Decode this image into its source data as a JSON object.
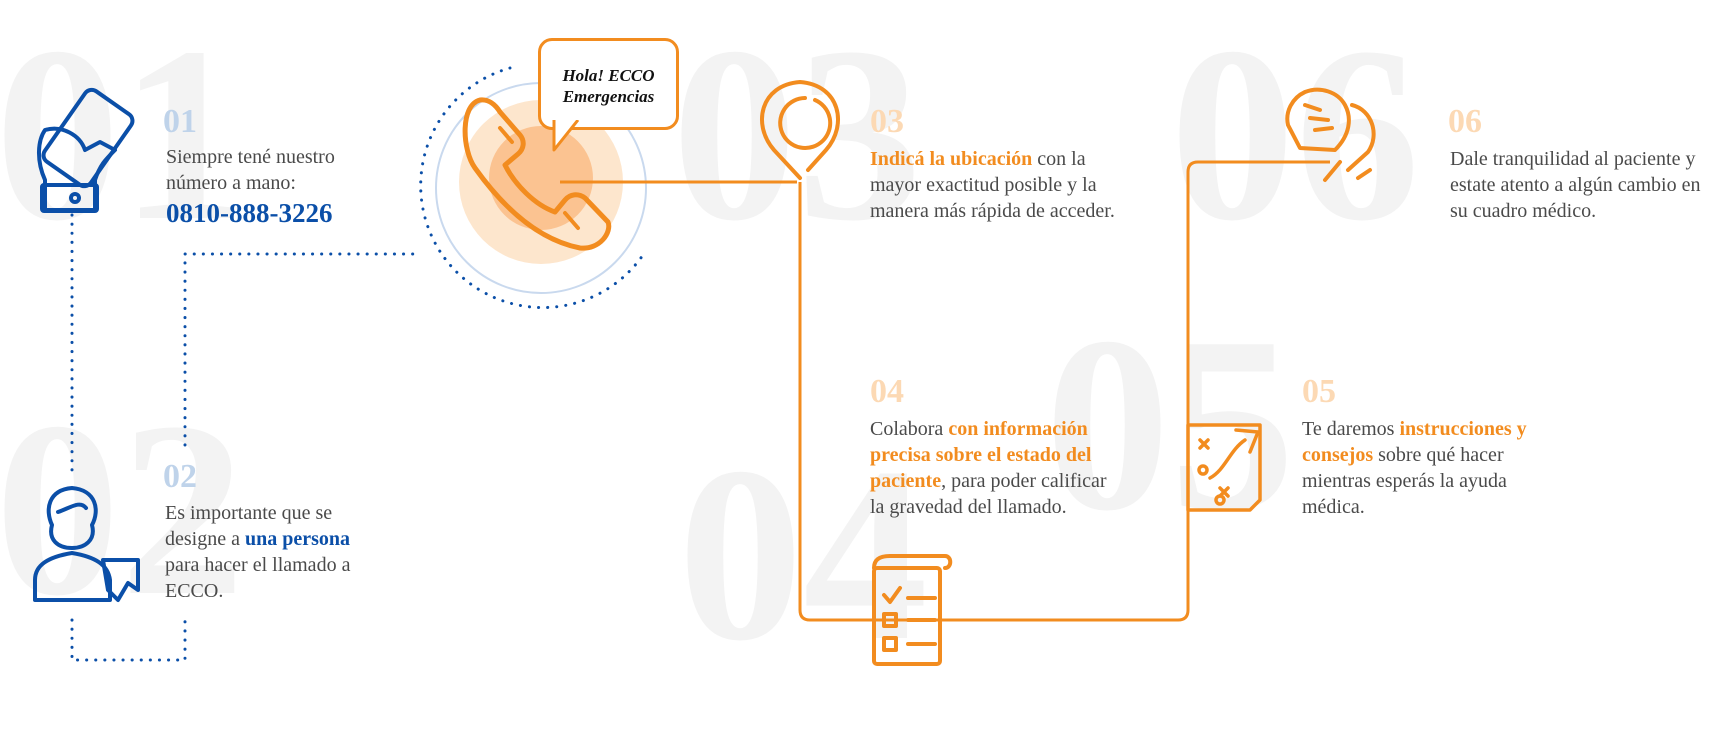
{
  "colors": {
    "orange": "#f28c1f",
    "blue": "#0b4fa8",
    "light_blue": "#bfd3ea",
    "light_orange": "#fcd9b4",
    "watermark": "#f3f3f3",
    "text": "#4a4a4a"
  },
  "watermarks": [
    "01",
    "02",
    "03",
    "04",
    "05",
    "06"
  ],
  "bubble": {
    "line1": "Hola! ECCO",
    "line2": "Emergencias"
  },
  "steps": [
    {
      "number": "01",
      "icon": "hand-phone-icon",
      "text": "Siempre tené nuestro número a mano:",
      "phone": "0810-888-3226"
    },
    {
      "number": "02",
      "icon": "woman-badge-icon",
      "text_before": "Es importante que se designe a ",
      "highlight": "una persona",
      "text_after": " para hacer el llamado a ECCO."
    },
    {
      "number": "03",
      "icon": "location-pin-icon",
      "highlight": "Indicá la ubicación",
      "text_after": " con la mayor exactitud posible y la manera más rápida de acceder."
    },
    {
      "number": "04",
      "icon": "checklist-icon",
      "text_before": "Colabora ",
      "highlight": "con información precisa sobre el estado del paciente",
      "text_after": ", para poder calificar la gravedad del llamado."
    },
    {
      "number": "05",
      "icon": "strategy-board-icon",
      "text_before": "Te daremos ",
      "highlight": "instrucciones y consejos",
      "text_after": " sobre qué hacer mientras esperás la ayuda médica."
    },
    {
      "number": "06",
      "icon": "handshake-icon",
      "text": "Dale tranquilidad al paciente y estate atento a algún cambio en su cuadro médico."
    }
  ]
}
